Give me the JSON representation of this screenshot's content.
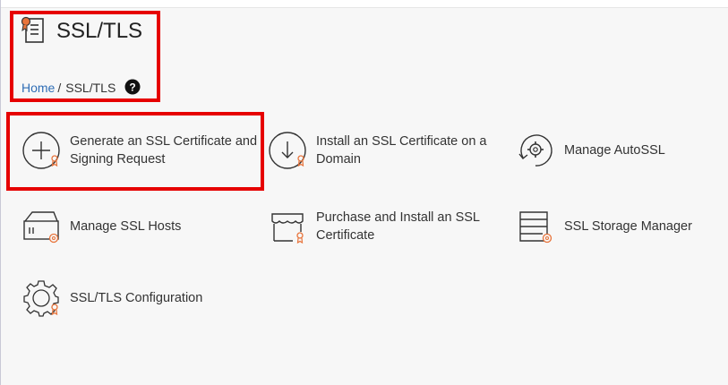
{
  "page": {
    "title": "SSL/TLS",
    "breadcrumb": {
      "home": "Home",
      "separator": "/",
      "current": "SSL/TLS"
    },
    "help_icon": "question-circle-icon"
  },
  "features": [
    {
      "label": "Generate an SSL Certificate and Signing Request",
      "icon": "plus-circle-ribbon-icon"
    },
    {
      "label": "Install an SSL Certificate on a Domain",
      "icon": "download-circle-icon"
    },
    {
      "label": "Manage AutoSSL",
      "icon": "refresh-gear-icon"
    },
    {
      "label": "Manage SSL Hosts",
      "icon": "server-gear-icon"
    },
    {
      "label": "Purchase and Install an SSL Certificate",
      "icon": "storefront-ribbon-icon"
    },
    {
      "label": "SSL Storage Manager",
      "icon": "storage-gear-icon"
    },
    {
      "label": "SSL/TLS Configuration",
      "icon": "gear-ribbon-icon"
    }
  ],
  "colors": {
    "highlight": "#e60000",
    "link": "#2f6db5",
    "accent": "#e8743b",
    "icon_stroke": "#333333"
  }
}
